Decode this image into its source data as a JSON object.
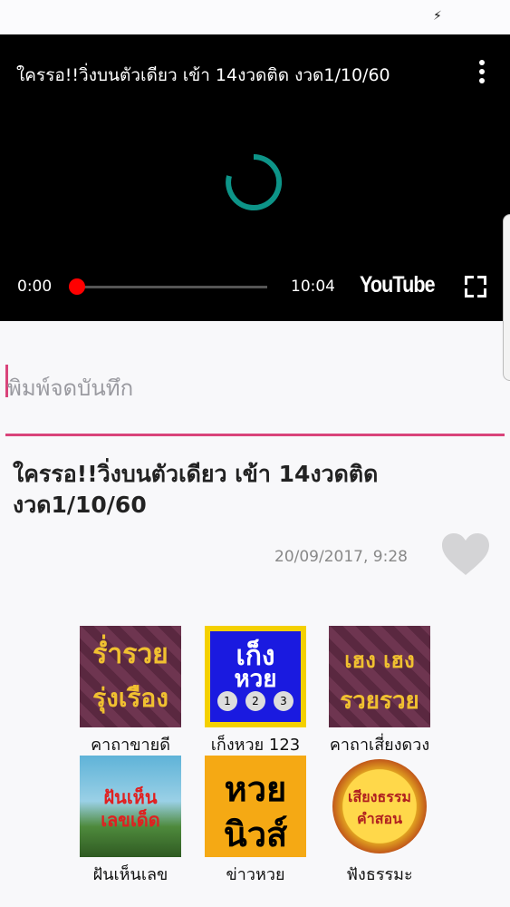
{
  "video": {
    "title": "ใครรอ!!วิ่งบนตัวเดียว เข้า 14งวดติด งวด1/10/60",
    "current_time": "0:00",
    "duration": "10:04",
    "progress_fraction": 0.0,
    "logo": "YouTube"
  },
  "note": {
    "placeholder": "พิมพ์จดบันทึก"
  },
  "article": {
    "title": "ใครรอ!!วิ่งบนตัวเดียว เข้า 14งวดติด งวด1/10/60",
    "timestamp": "20/09/2017, 9:28"
  },
  "apps": [
    {
      "label": "คาถาขายดี",
      "icon": "rich-prosper-icon",
      "icon_text": [
        "ร่ำรวย",
        "รุ่งเรือง"
      ]
    },
    {
      "label": "เก็งหวย 123",
      "icon": "lottery-guess-icon",
      "icon_text": [
        "เก็ง",
        "หวย"
      ]
    },
    {
      "label": "คาถาเสี่ยงดวง",
      "icon": "heng-heng-icon",
      "icon_text": [
        "เฮง เฮง",
        "รวยรวย"
      ]
    },
    {
      "label": "ฝันเห็นเลข",
      "icon": "dream-number-icon",
      "icon_text": [
        "ฝันเห็น",
        "เลขเด็ด"
      ]
    },
    {
      "label": "ข่าวหวย",
      "icon": "lottery-news-icon",
      "icon_text": [
        "หวย",
        "นิวส์"
      ]
    },
    {
      "label": "ฟังธรรมะ",
      "icon": "dharma-audio-icon",
      "icon_text": [
        "เสียงธรรม",
        "คำสอน"
      ]
    }
  ],
  "colors": {
    "accent": "#d9437a",
    "spinner": "#0d9488",
    "progress": "#ff0000"
  }
}
